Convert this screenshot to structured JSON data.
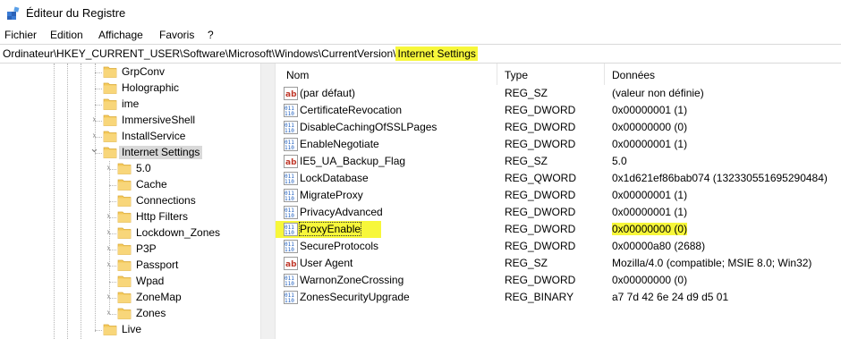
{
  "window": {
    "title": "Éditeur du Registre"
  },
  "menu": [
    "Fichier",
    "Edition",
    "Affichage",
    "Favoris",
    "?"
  ],
  "address": {
    "prefix": "Ordinateur\\HKEY_CURRENT_USER\\Software\\Microsoft\\Windows\\CurrentVersion\\",
    "highlighted": "Internet Settings"
  },
  "tree": {
    "items": [
      {
        "label": "GrpConv",
        "expand": "none",
        "depth": 0
      },
      {
        "label": "Holographic",
        "expand": "none",
        "depth": 0
      },
      {
        "label": "ime",
        "expand": "none",
        "depth": 0
      },
      {
        "label": "ImmersiveShell",
        "expand": "collapsed",
        "depth": 0
      },
      {
        "label": "InstallService",
        "expand": "collapsed",
        "depth": 0
      },
      {
        "label": "Internet Settings",
        "expand": "expanded",
        "depth": 0,
        "selected": true
      },
      {
        "label": "5.0",
        "expand": "collapsed",
        "depth": 1
      },
      {
        "label": "Cache",
        "expand": "none",
        "depth": 1
      },
      {
        "label": "Connections",
        "expand": "none",
        "depth": 1
      },
      {
        "label": "Http Filters",
        "expand": "collapsed",
        "depth": 1
      },
      {
        "label": "Lockdown_Zones",
        "expand": "collapsed",
        "depth": 1
      },
      {
        "label": "P3P",
        "expand": "collapsed",
        "depth": 1
      },
      {
        "label": "Passport",
        "expand": "collapsed",
        "depth": 1
      },
      {
        "label": "Wpad",
        "expand": "none",
        "depth": 1
      },
      {
        "label": "ZoneMap",
        "expand": "collapsed",
        "depth": 1
      },
      {
        "label": "Zones",
        "expand": "collapsed",
        "depth": 1
      },
      {
        "label": "Live",
        "expand": "none",
        "depth": 0
      }
    ]
  },
  "list": {
    "columns": {
      "name": "Nom",
      "type": "Type",
      "data": "Données"
    },
    "rows": [
      {
        "icon": "string-value-icon",
        "name": "(par défaut)",
        "type": "REG_SZ",
        "data": "(valeur non définie)"
      },
      {
        "icon": "binary-value-icon",
        "name": "CertificateRevocation",
        "type": "REG_DWORD",
        "data": "0x00000001 (1)"
      },
      {
        "icon": "binary-value-icon",
        "name": "DisableCachingOfSSLPages",
        "type": "REG_DWORD",
        "data": "0x00000000 (0)"
      },
      {
        "icon": "binary-value-icon",
        "name": "EnableNegotiate",
        "type": "REG_DWORD",
        "data": "0x00000001 (1)"
      },
      {
        "icon": "string-value-icon",
        "name": "IE5_UA_Backup_Flag",
        "type": "REG_SZ",
        "data": "5.0"
      },
      {
        "icon": "binary-value-icon",
        "name": "LockDatabase",
        "type": "REG_QWORD",
        "data": "0x1d621ef86bab074 (132330551695290484)"
      },
      {
        "icon": "binary-value-icon",
        "name": "MigrateProxy",
        "type": "REG_DWORD",
        "data": "0x00000001 (1)"
      },
      {
        "icon": "binary-value-icon",
        "name": "PrivacyAdvanced",
        "type": "REG_DWORD",
        "data": "0x00000001 (1)"
      },
      {
        "icon": "binary-value-icon",
        "name": "ProxyEnable",
        "type": "REG_DWORD",
        "data": "0x00000000 (0)",
        "highlight": true
      },
      {
        "icon": "binary-value-icon",
        "name": "SecureProtocols",
        "type": "REG_DWORD",
        "data": "0x00000a80 (2688)"
      },
      {
        "icon": "string-value-icon",
        "name": "User Agent",
        "type": "REG_SZ",
        "data": "Mozilla/4.0 (compatible; MSIE 8.0; Win32)"
      },
      {
        "icon": "binary-value-icon",
        "name": "WarnonZoneCrossing",
        "type": "REG_DWORD",
        "data": "0x00000000 (0)"
      },
      {
        "icon": "binary-value-icon",
        "name": "ZonesSecurityUpgrade",
        "type": "REG_BINARY",
        "data": "a7 7d 42 6e 24 d9 d5 01"
      }
    ]
  },
  "colors": {
    "highlight": "#f7f73a",
    "folder": "#f4c95a",
    "selected": "#d9d9d9"
  }
}
